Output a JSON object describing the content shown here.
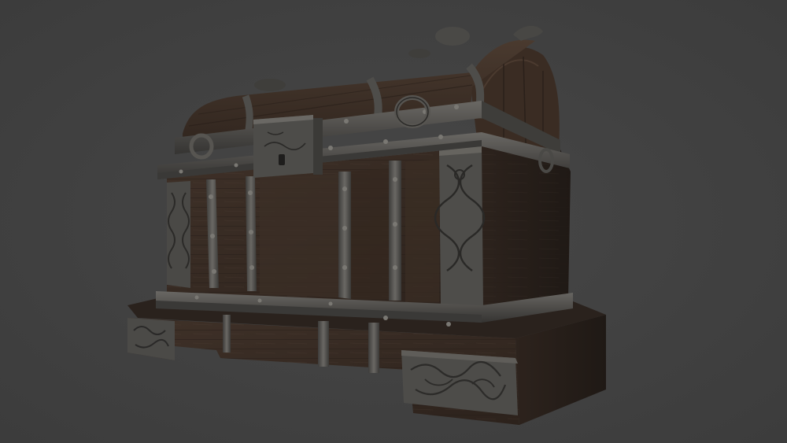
{
  "scene": {
    "subject_icon": "chest-icon",
    "colors": {
      "background": "#414141",
      "wood_dark": "#2f241d",
      "wood_mid": "#3b2e25",
      "wood_light": "#4a3a2f",
      "iron_dark": "#2b2b2a",
      "iron_mid": "#4a4947",
      "iron_light": "#6a6864"
    }
  }
}
